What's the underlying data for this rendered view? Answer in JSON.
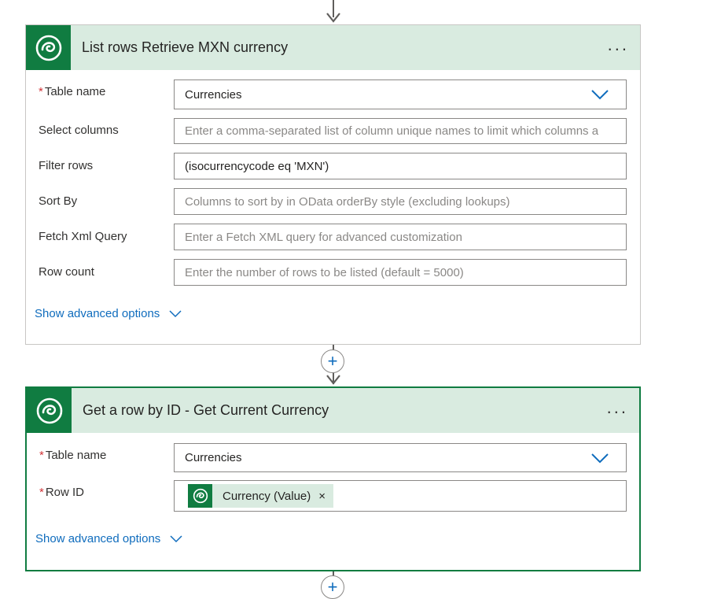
{
  "card1": {
    "title": "List rows Retrieve MXN currency",
    "more": "...",
    "fields": {
      "table_name": {
        "label": "Table name",
        "required": "*",
        "value": "Currencies"
      },
      "select_columns": {
        "label": "Select columns",
        "placeholder": "Enter a comma-separated list of column unique names to limit which columns a"
      },
      "filter_rows": {
        "label": "Filter rows",
        "value": "(isocurrencycode eq 'MXN')"
      },
      "sort_by": {
        "label": "Sort By",
        "placeholder": "Columns to sort by in OData orderBy style (excluding lookups)"
      },
      "fetch_xml": {
        "label": "Fetch Xml Query",
        "placeholder": "Enter a Fetch XML query for advanced customization"
      },
      "row_count": {
        "label": "Row count",
        "placeholder": "Enter the number of rows to be listed (default = 5000)"
      }
    },
    "advanced": "Show advanced options"
  },
  "connector": {
    "plus": "+"
  },
  "card2": {
    "title": "Get a row by ID - Get Current Currency",
    "more": "...",
    "fields": {
      "table_name": {
        "label": "Table name",
        "required": "*",
        "value": "Currencies"
      },
      "row_id": {
        "label": "Row ID",
        "required": "*",
        "token": "Currency (Value)",
        "token_remove": "×"
      }
    },
    "advanced": "Show advanced options"
  },
  "colors": {
    "brand_green": "#107c41",
    "header_bg": "#d9ebe0",
    "link_blue": "#0f6cbd",
    "required_red": "#d13438"
  },
  "icons": {
    "logo": "dataverse-icon",
    "dropdown": "chevron-down-icon",
    "more": "more-options-icon",
    "arrow": "arrow-down-icon"
  }
}
